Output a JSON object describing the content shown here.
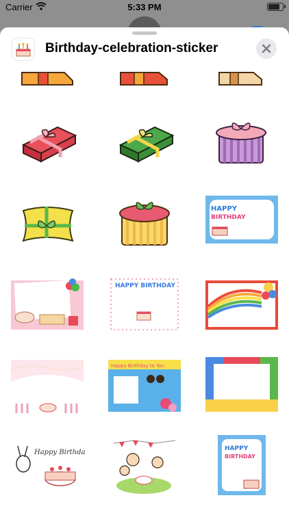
{
  "status": {
    "carrier": "Carrier",
    "time": "5:33 PM"
  },
  "header": {
    "title": "Birthday-celebration-sticker"
  },
  "icons": {
    "app": "cake-icon",
    "close": "close-icon",
    "wifi": "wifi-icon",
    "battery": "battery-icon"
  },
  "stickers": [
    "gift-box-orange-partial",
    "gift-box-orange-red-partial",
    "gift-box-tan-partial",
    "gift-box-red",
    "gift-box-green",
    "round-hatbox-purple",
    "pillow-box-yellow",
    "round-hatbox-yellow",
    "happy-birthday-card-blue",
    "photo-frame-pink-cake",
    "happy-birthday-card-dotted",
    "rainbow-balloon-card",
    "star-garland-pink-card",
    "happy-birthday-family-frame",
    "flower-frame-colorful",
    "bunny-birthday-cake",
    "family-party-celebration",
    "happy-birthday-card-vertical"
  ],
  "colors": {
    "sheet": "#ffffff",
    "dim": "#8f8f8f",
    "accent": "#3a78d2"
  }
}
